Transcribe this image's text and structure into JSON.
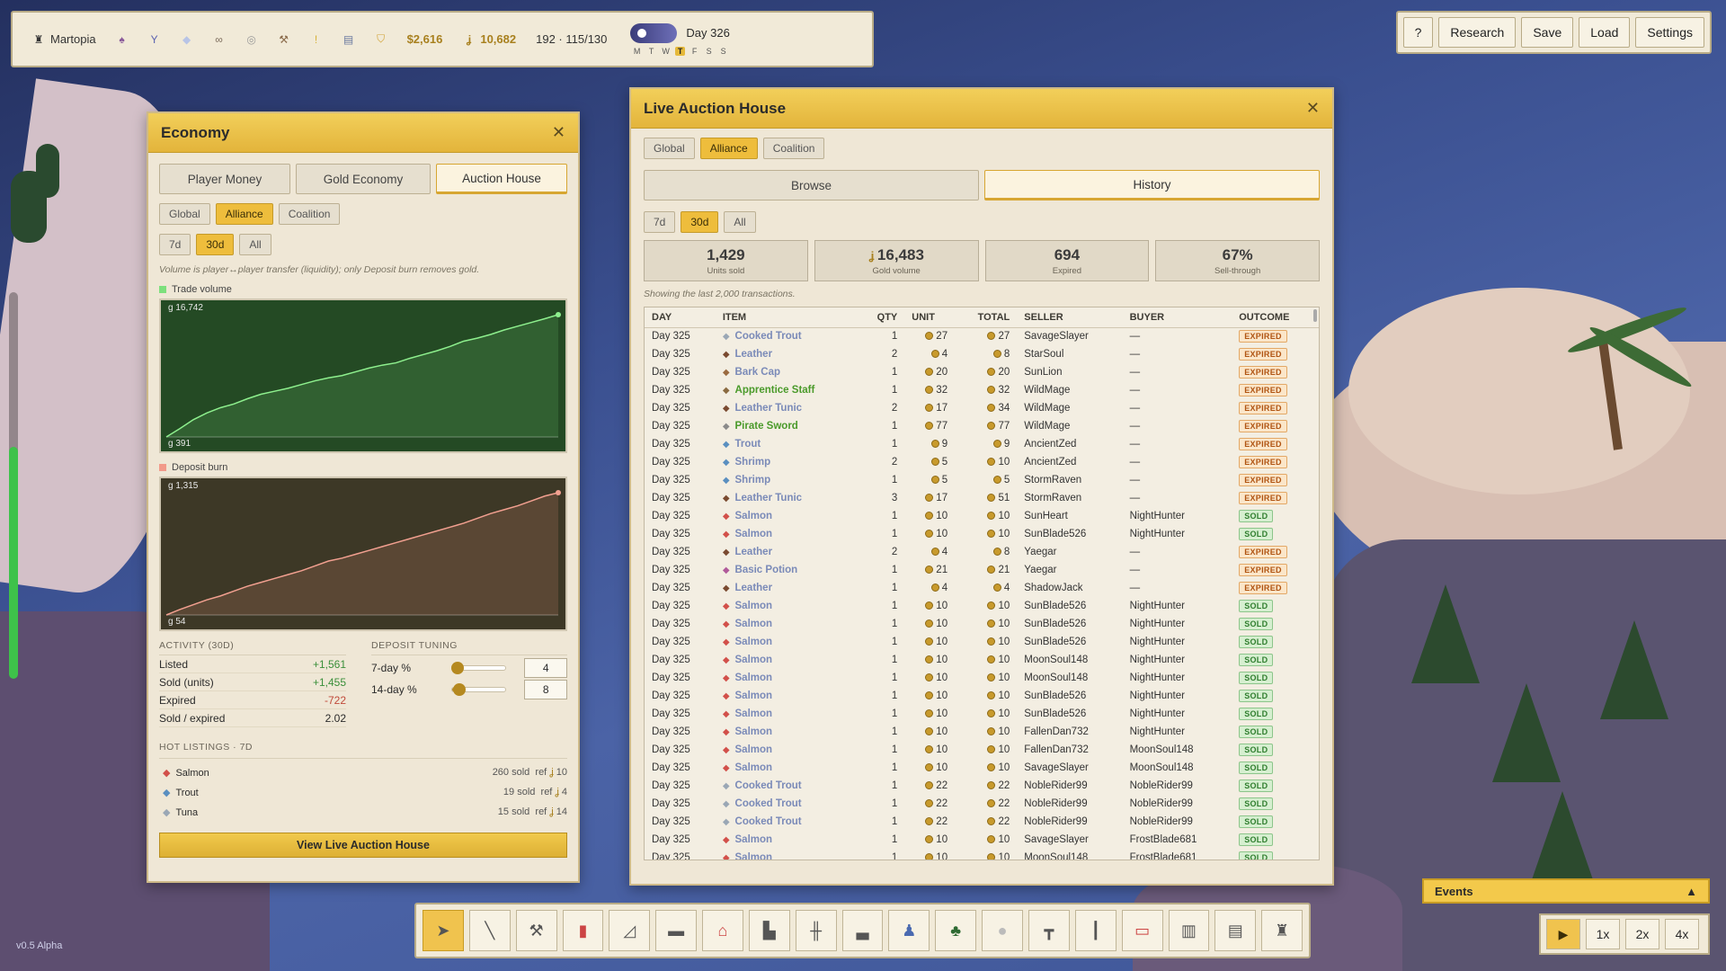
{
  "topbar": {
    "city": "Martopia",
    "money": "$2,616",
    "gold": "10,682",
    "pop": "192 · 115/130",
    "day": "Day 326",
    "weekdays": [
      "M",
      "T",
      "W",
      "T",
      "F",
      "S",
      "S"
    ]
  },
  "top_buttons": {
    "help": "?",
    "research": "Research",
    "save": "Save",
    "load": "Load",
    "settings": "Settings"
  },
  "economy": {
    "title": "Economy",
    "tabs": [
      "Player Money",
      "Gold Economy",
      "Auction House"
    ],
    "scope_tabs": [
      "Global",
      "Alliance",
      "Coalition"
    ],
    "range_tabs": [
      "7d",
      "30d",
      "All"
    ],
    "note": "Volume is player↔player transfer (liquidity); only Deposit burn removes gold.",
    "trade_legend": "Trade volume",
    "trade_max": "g 16,742",
    "trade_min": "g 391",
    "burn_legend": "Deposit burn",
    "burn_max": "g 1,315",
    "burn_min": "g 54",
    "activity_h": "ACTIVITY (30D)",
    "deposit_h": "DEPOSIT TUNING",
    "activity": [
      {
        "label": "Listed",
        "value": "+1,561",
        "cls": "pos"
      },
      {
        "label": "Sold (units)",
        "value": "+1,455",
        "cls": "pos"
      },
      {
        "label": "Expired",
        "value": "-722",
        "cls": "neg"
      },
      {
        "label": "Sold / expired",
        "value": "2.02",
        "cls": ""
      }
    ],
    "tuning": [
      {
        "label": "7-day %",
        "value": "4",
        "level": 0.1
      },
      {
        "label": "14-day %",
        "value": "8",
        "level": 0.14
      }
    ],
    "hot_h": "HOT LISTINGS · 7D",
    "hot": [
      {
        "name": "Salmon",
        "sold": "260 sold",
        "ref": "ref",
        "price": "10",
        "color": "#d2504a"
      },
      {
        "name": "Trout",
        "sold": "19 sold",
        "ref": "ref",
        "price": "4",
        "color": "#5a8fc0"
      },
      {
        "name": "Tuna",
        "sold": "15 sold",
        "ref": "ref",
        "price": "14",
        "color": "#9aa7b5"
      }
    ],
    "view_btn": "View Live Auction House"
  },
  "auction": {
    "title": "Live Auction House",
    "scope_tabs": [
      "Global",
      "Alliance",
      "Coalition"
    ],
    "view_tabs": [
      "Browse",
      "History"
    ],
    "range_tabs": [
      "7d",
      "30d",
      "All"
    ],
    "stats": [
      {
        "value": "1,429",
        "label": "Units sold"
      },
      {
        "value": "16,483",
        "label": "Gold volume"
      },
      {
        "value": "694",
        "label": "Expired"
      },
      {
        "value": "67%",
        "label": "Sell-through"
      }
    ],
    "showing": "Showing the last 2,000 transactions.",
    "columns": [
      "DAY",
      "ITEM",
      "QTY",
      "UNIT",
      "TOTAL",
      "SELLER",
      "BUYER",
      "OUTCOME"
    ],
    "rows": [
      [
        "Day 325",
        "Cooked Trout",
        "1",
        "27",
        "27",
        "SavageSlayer",
        "—",
        "EXPIRED"
      ],
      [
        "Day 325",
        "Leather",
        "2",
        "4",
        "8",
        "StarSoul",
        "—",
        "EXPIRED"
      ],
      [
        "Day 325",
        "Bark Cap",
        "1",
        "20",
        "20",
        "SunLion",
        "—",
        "EXPIRED"
      ],
      [
        "Day 325",
        "Apprentice Staff",
        "1",
        "32",
        "32",
        "WildMage",
        "—",
        "EXPIRED"
      ],
      [
        "Day 325",
        "Leather Tunic",
        "2",
        "17",
        "34",
        "WildMage",
        "—",
        "EXPIRED"
      ],
      [
        "Day 325",
        "Pirate Sword",
        "1",
        "77",
        "77",
        "WildMage",
        "—",
        "EXPIRED"
      ],
      [
        "Day 325",
        "Trout",
        "1",
        "9",
        "9",
        "AncientZed",
        "—",
        "EXPIRED"
      ],
      [
        "Day 325",
        "Shrimp",
        "2",
        "5",
        "10",
        "AncientZed",
        "—",
        "EXPIRED"
      ],
      [
        "Day 325",
        "Shrimp",
        "1",
        "5",
        "5",
        "StormRaven",
        "—",
        "EXPIRED"
      ],
      [
        "Day 325",
        "Leather Tunic",
        "3",
        "17",
        "51",
        "StormRaven",
        "—",
        "EXPIRED"
      ],
      [
        "Day 325",
        "Salmon",
        "1",
        "10",
        "10",
        "SunHeart",
        "NightHunter",
        "SOLD"
      ],
      [
        "Day 325",
        "Salmon",
        "1",
        "10",
        "10",
        "SunBlade526",
        "NightHunter",
        "SOLD"
      ],
      [
        "Day 325",
        "Leather",
        "2",
        "4",
        "8",
        "Yaegar",
        "—",
        "EXPIRED"
      ],
      [
        "Day 325",
        "Basic Potion",
        "1",
        "21",
        "21",
        "Yaegar",
        "—",
        "EXPIRED"
      ],
      [
        "Day 325",
        "Leather",
        "1",
        "4",
        "4",
        "ShadowJack",
        "—",
        "EXPIRED"
      ],
      [
        "Day 325",
        "Salmon",
        "1",
        "10",
        "10",
        "SunBlade526",
        "NightHunter",
        "SOLD"
      ],
      [
        "Day 325",
        "Salmon",
        "1",
        "10",
        "10",
        "SunBlade526",
        "NightHunter",
        "SOLD"
      ],
      [
        "Day 325",
        "Salmon",
        "1",
        "10",
        "10",
        "SunBlade526",
        "NightHunter",
        "SOLD"
      ],
      [
        "Day 325",
        "Salmon",
        "1",
        "10",
        "10",
        "MoonSoul148",
        "NightHunter",
        "SOLD"
      ],
      [
        "Day 325",
        "Salmon",
        "1",
        "10",
        "10",
        "MoonSoul148",
        "NightHunter",
        "SOLD"
      ],
      [
        "Day 325",
        "Salmon",
        "1",
        "10",
        "10",
        "SunBlade526",
        "NightHunter",
        "SOLD"
      ],
      [
        "Day 325",
        "Salmon",
        "1",
        "10",
        "10",
        "SunBlade526",
        "NightHunter",
        "SOLD"
      ],
      [
        "Day 325",
        "Salmon",
        "1",
        "10",
        "10",
        "FallenDan732",
        "NightHunter",
        "SOLD"
      ],
      [
        "Day 325",
        "Salmon",
        "1",
        "10",
        "10",
        "FallenDan732",
        "MoonSoul148",
        "SOLD"
      ],
      [
        "Day 325",
        "Salmon",
        "1",
        "10",
        "10",
        "SavageSlayer",
        "MoonSoul148",
        "SOLD"
      ],
      [
        "Day 325",
        "Cooked Trout",
        "1",
        "22",
        "22",
        "NobleRider99",
        "NobleRider99",
        "SOLD"
      ],
      [
        "Day 325",
        "Cooked Trout",
        "1",
        "22",
        "22",
        "NobleRider99",
        "NobleRider99",
        "SOLD"
      ],
      [
        "Day 325",
        "Cooked Trout",
        "1",
        "22",
        "22",
        "NobleRider99",
        "NobleRider99",
        "SOLD"
      ],
      [
        "Day 325",
        "Salmon",
        "1",
        "10",
        "10",
        "SavageSlayer",
        "FrostBlade681",
        "SOLD"
      ],
      [
        "Day 325",
        "Salmon",
        "1",
        "10",
        "10",
        "MoonSoul148",
        "FrostBlade681",
        "SOLD"
      ]
    ]
  },
  "events_label": "Events",
  "speeds": [
    "1x",
    "2x",
    "4x"
  ],
  "version": "v0.5 Alpha",
  "health_level": 0.6,
  "chart_data": [
    {
      "type": "area",
      "title": "Trade volume",
      "ylim": [
        391,
        16742
      ],
      "x": [
        0,
        1,
        2,
        3,
        4,
        5,
        6,
        7,
        8,
        9,
        10,
        11,
        12,
        13,
        14,
        15,
        16,
        17,
        18,
        19,
        20,
        21,
        22,
        23,
        24,
        25,
        26,
        27,
        28,
        29
      ],
      "values": [
        391,
        1500,
        2700,
        3600,
        4300,
        4800,
        5500,
        6100,
        6500,
        6900,
        7400,
        7900,
        8300,
        8600,
        9100,
        9600,
        10000,
        10300,
        10900,
        11400,
        11900,
        12500,
        13200,
        13600,
        14100,
        14700,
        15200,
        15700,
        16200,
        16742
      ]
    },
    {
      "type": "area",
      "title": "Deposit burn",
      "ylim": [
        54,
        1315
      ],
      "x": [
        0,
        1,
        2,
        3,
        4,
        5,
        6,
        7,
        8,
        9,
        10,
        11,
        12,
        13,
        14,
        15,
        16,
        17,
        18,
        19,
        20,
        21,
        22,
        23,
        24,
        25,
        26,
        27,
        28,
        29
      ],
      "values": [
        54,
        110,
        160,
        210,
        250,
        300,
        350,
        390,
        430,
        470,
        510,
        560,
        610,
        640,
        680,
        720,
        760,
        800,
        840,
        880,
        920,
        960,
        1000,
        1050,
        1100,
        1140,
        1180,
        1230,
        1280,
        1315
      ]
    }
  ]
}
